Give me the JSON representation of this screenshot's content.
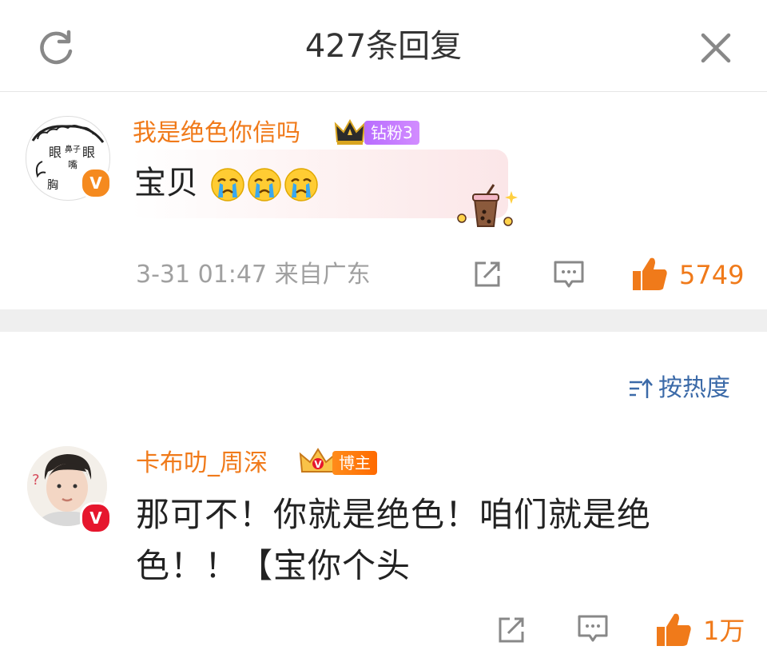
{
  "header": {
    "title": "427条回复"
  },
  "main_comment": {
    "username": "我是绝色你信吗",
    "fan_badge": "钻粉3",
    "content": "宝贝",
    "emoji_count": 3,
    "timestamp": "3-31 01:47 来自广东",
    "like_count": "5749",
    "avatar_texts": [
      "眼",
      "鼻子",
      "眼",
      "嘴",
      "胸"
    ]
  },
  "sort": {
    "label": "按热度"
  },
  "reply": {
    "username": "卡布叻_周深",
    "role_badge": "博主",
    "content": "那可不！你就是绝色！咱们就是绝色！！【宝你个头",
    "like_count": "1万"
  },
  "colors": {
    "username": "#f07a1a",
    "sort": "#3b6aa8",
    "meta": "#a0a0a0",
    "divider": "#efefef"
  }
}
